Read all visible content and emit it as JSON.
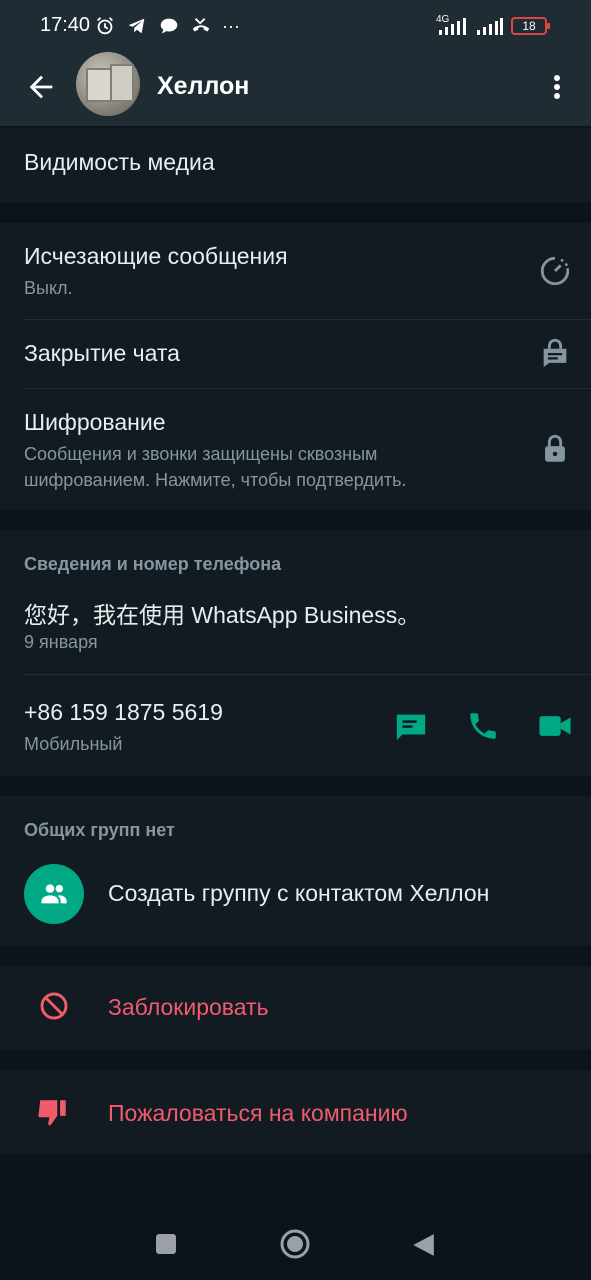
{
  "status_bar": {
    "time": "17:40",
    "network": "4G",
    "battery": "18",
    "more": "···"
  },
  "header": {
    "contact_name": "Хеллон",
    "back_icon": "arrow-left-icon",
    "menu_icon": "more-vert-icon"
  },
  "media": {
    "label": "Видимость медиа"
  },
  "privacy": {
    "disappearing": {
      "title": "Исчезающие сообщения",
      "value": "Выкл."
    },
    "chat_lock": {
      "title": "Закрытие чата"
    },
    "encryption": {
      "title": "Шифрование",
      "desc_line1": "Сообщения и звонки защищены сквозным",
      "desc_line2": "шифрованием. Нажмите, чтобы подтвердить."
    }
  },
  "info": {
    "heading": "Сведения и номер телефона",
    "about": "您好，我在使用 WhatsApp Business。",
    "about_date": "9 января",
    "phone": "+86 159 1875 5619",
    "phone_type": "Мобильный"
  },
  "groups": {
    "heading": "Общих групп нет",
    "create_label": "Создать группу с контактом Хеллон"
  },
  "actions": {
    "block": "Заблокировать",
    "report": "Пожаловаться на компанию"
  },
  "colors": {
    "accent": "#00a884",
    "danger": "#f15c6d",
    "background": "#0b141a",
    "panel": "#111b21"
  }
}
